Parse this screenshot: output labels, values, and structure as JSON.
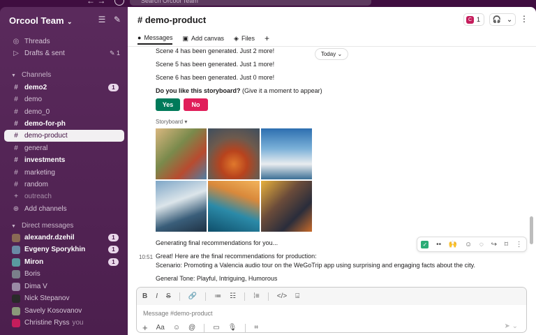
{
  "topbar": {
    "search_placeholder": "Search Orcool Team"
  },
  "workspace": {
    "name": "Orcool Team"
  },
  "sidebar": {
    "top_items": [
      {
        "label": "Threads"
      },
      {
        "label": "Drafts & sent",
        "count": "1"
      }
    ],
    "channels_header": "Channels",
    "channels": [
      {
        "label": "demo2",
        "bold": true,
        "badge": "1"
      },
      {
        "label": "demo"
      },
      {
        "label": "demo_0"
      },
      {
        "label": "demo-for-ph",
        "bold": true
      },
      {
        "label": "demo-product",
        "selected": true
      },
      {
        "label": "general"
      },
      {
        "label": "investments",
        "bold": true
      },
      {
        "label": "marketing"
      },
      {
        "label": "random"
      },
      {
        "label": "outreach",
        "dim": true
      },
      {
        "label": "Add channels"
      }
    ],
    "dm_header": "Direct messages",
    "dms": [
      {
        "label": "alexandr.dzehil",
        "bold": true,
        "badge": "1",
        "color": "#8a6a55"
      },
      {
        "label": "Evgeny Sporykhin",
        "bold": true,
        "badge": "1",
        "color": "#6a8aa5"
      },
      {
        "label": "Miron",
        "bold": true,
        "badge": "1",
        "color": "#5a9aa0"
      },
      {
        "label": "Boris",
        "color": "#7a7f8a"
      },
      {
        "label": "Dima V",
        "color": "#9a8aa5"
      },
      {
        "label": "Nick Stepanov",
        "color": "#2a2a2a"
      },
      {
        "label": "Savely Kosovanov",
        "color": "#8a9a7a"
      },
      {
        "label": "Christine Ryss",
        "you": "you",
        "color": "#c51d5c"
      }
    ]
  },
  "channel": {
    "title": "demo-product",
    "members_count": "1",
    "tabs": [
      {
        "label": "Messages"
      },
      {
        "label": "Add canvas"
      },
      {
        "label": "Files"
      }
    ]
  },
  "messages": {
    "scene4": "Scene 4 has been generated. Just 2 more!",
    "scene5": "Scene 5 has been generated. Just 1 more!",
    "scene6": "Scene 6 has been generated. Just 0 more!",
    "question_bold": "Do you like this storyboard?",
    "question_rest": " (Give it a moment to appear)",
    "yes": "Yes",
    "no": "No",
    "storyboard_label": "Storyboard",
    "today": "Today",
    "generating": "Generating final recommendations for you...",
    "time": "10:51",
    "final_line1": "Great! Here are the final recommendations for production:",
    "final_line2": "Scenario: Promoting a Valencia audio tour on the WeGoTrip app using surprising and engaging facts about the city.",
    "final_line3": "General Tone:  Playful, Intriguing, Humorous"
  },
  "composer": {
    "placeholder": "Message #demo-product"
  }
}
